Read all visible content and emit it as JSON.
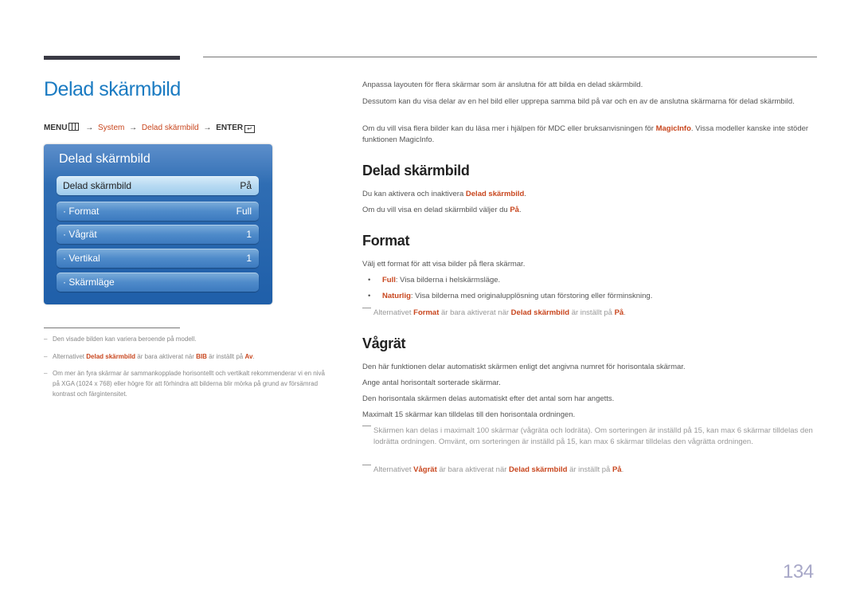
{
  "page_title": "Delad skärmbild",
  "menu_path": {
    "menu_label": "MENU",
    "menu_icon": "menu-icon",
    "arrow": "→",
    "system": "System",
    "delad": "Delad skärmbild",
    "enter_label": "ENTER",
    "enter_icon": "enter-icon",
    "enter_glyph": "↵"
  },
  "osd": {
    "title": "Delad skärmbild",
    "items": [
      {
        "label": "Delad skärmbild",
        "value": "På"
      },
      {
        "label": "· Format",
        "value": "Full"
      },
      {
        "label": "· Vågrät",
        "value": "1"
      },
      {
        "label": "· Vertikal",
        "value": "1"
      },
      {
        "label": "· Skärmläge",
        "value": ""
      }
    ]
  },
  "footnotes": {
    "dash": "–",
    "n1": "Den visade bilden kan variera beroende på modell.",
    "n2_pre": "Alternativet ",
    "n2_hl1": "Delad skärmbild",
    "n2_mid": " är bara aktiverat när ",
    "n2_hl2": "BIB",
    "n2_mid2": " är inställt på ",
    "n2_hl3": "Av",
    "n2_end": ".",
    "n3": "Om mer än fyra skärmar är sammankopplade horisontellt och vertikalt rekommenderar vi en nivå på XGA (1024 x 768) eller högre för att förhindra att bilderna blir mörka på grund av försämrad kontrast och färgintensitet."
  },
  "intro": {
    "p1": "Anpassa layouten för flera skärmar som är anslutna för att bilda en delad skärmbild.",
    "p2": "Dessutom kan du visa delar av en hel bild eller upprepa samma bild på var och en av de anslutna skärmarna för delad skärmbild.",
    "p3_pre": "Om du vill visa flera bilder kan du läsa mer i hjälpen för MDC eller bruksanvisningen för ",
    "p3_hl": "MagicInfo",
    "p3_end": ". Vissa modeller kanske inte stöder funktionen MagicInfo."
  },
  "section_delad": {
    "heading": "Delad skärmbild",
    "p1_pre": "Du kan aktivera och inaktivera ",
    "p1_hl": "Delad skärmbild",
    "p1_end": ".",
    "p2_pre": "Om du vill visa en delad skärmbild väljer du ",
    "p2_hl": "På",
    "p2_end": "."
  },
  "section_format": {
    "heading": "Format",
    "p1": "Välj ett format för att visa bilder på flera skärmar.",
    "bullet_glyph": "•",
    "b1_hl": "Full",
    "b1_text": ": Visa bilderna i helskärmsläge.",
    "b2_hl": "Naturlig",
    "b2_text": ": Visa bilderna med originalupplösning utan förstoring eller förminskning.",
    "note_pre": "Alternativet ",
    "note_hl1": "Format",
    "note_mid": " är bara aktiverat när ",
    "note_hl2": "Delad skärmbild",
    "note_mid2": " är inställt på ",
    "note_hl3": "På",
    "note_end": "."
  },
  "section_vagrat": {
    "heading": "Vågrät",
    "p1": "Den här funktionen delar automatiskt skärmen enligt det angivna numret för horisontala skärmar.",
    "p2": "Ange antal horisontalt sorterade skärmar.",
    "p3": "Den horisontala skärmen delas automatiskt efter det antal som har angetts.",
    "p4": "Maximalt 15 skärmar kan tilldelas till den horisontala ordningen.",
    "note1": "Skärmen kan delas i maximalt 100 skärmar (vågräta och lodräta). Om sorteringen är inställd på 15, kan max 6 skärmar tilldelas den lodrätta ordningen. Omvänt, om sorteringen är inställd på 15, kan max 6 skärmar tilldelas den vågrätta ordningen.",
    "note2_pre": "Alternativet ",
    "note2_hl1": "Vågrät",
    "note2_mid": " är bara aktiverat när ",
    "note2_hl2": "Delad skärmbild",
    "note2_mid2": " är inställt på ",
    "note2_hl3": "På",
    "note2_end": "."
  },
  "page_number": "134"
}
